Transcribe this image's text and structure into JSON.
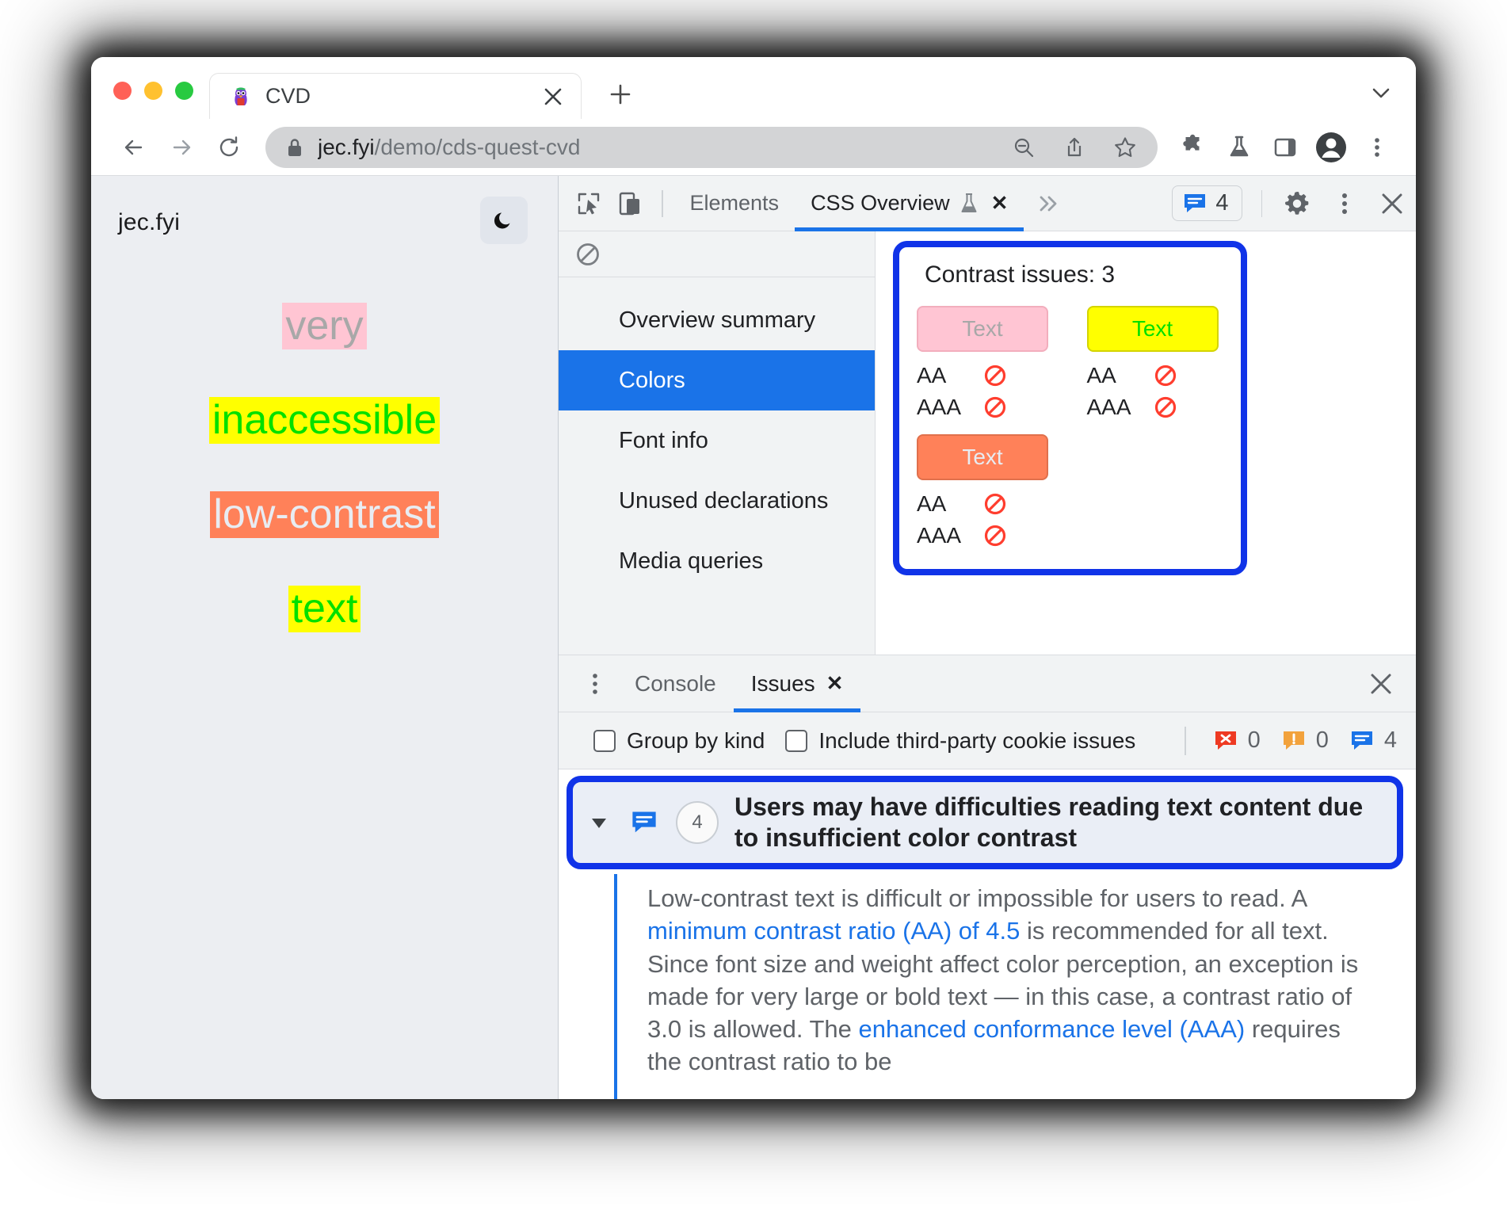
{
  "browser": {
    "tab": {
      "title": "CVD",
      "favicon_icon": "puffin-avatar-icon",
      "close_icon": "close-icon"
    },
    "new_tab_icon": "plus-icon",
    "tablist_chevron_icon": "chevron-down-icon",
    "nav": {
      "back_icon": "arrow-left-icon",
      "forward_icon": "arrow-right-icon",
      "reload_icon": "reload-icon"
    },
    "omnibox": {
      "lock_icon": "lock-icon",
      "url_host": "jec.fyi",
      "url_path": "/demo/cds-quest-cvd",
      "zoom_out_icon": "zoom-out-icon",
      "share_icon": "share-icon",
      "bookmark_icon": "star-icon"
    },
    "toolbar_icons": [
      "extensions-puzzle-icon",
      "experiments-flask-icon",
      "side-panel-icon",
      "profile-avatar-icon",
      "chrome-menu-icon"
    ]
  },
  "page": {
    "brand": "jec.fyi",
    "theme_toggle_icon": "moon-icon",
    "samples": [
      {
        "text": "very",
        "color": "#a8a8a8",
        "background": "#ffc5d3"
      },
      {
        "text": "inaccessible",
        "color": "#00e000",
        "background": "#ffff00"
      },
      {
        "text": "low-contrast",
        "color": "#e8ecf2",
        "background": "#ff8159"
      },
      {
        "text": "text",
        "color": "#00e000",
        "background": "#ffff00"
      }
    ]
  },
  "devtools": {
    "header": {
      "inspect_icon": "inspect-cursor-icon",
      "device_toggle_icon": "device-toolbar-icon",
      "tabs": [
        {
          "label": "Elements",
          "active": false
        },
        {
          "label": "CSS Overview",
          "active": true,
          "flask_icon": "experiment-flask-icon",
          "close_icon": "close-icon"
        }
      ],
      "more_tabs_icon": "chevron-double-right-icon",
      "issues_badge": {
        "icon": "issue-info-icon",
        "count": "4"
      },
      "settings_icon": "gear-icon",
      "kebab_icon": "kebab-menu-icon",
      "close_icon": "close-icon"
    },
    "css_overview": {
      "clear_icon": "clear-overview-icon",
      "menu": [
        {
          "label": "Overview summary",
          "selected": false
        },
        {
          "label": "Colors",
          "selected": true
        },
        {
          "label": "Font info",
          "selected": false
        },
        {
          "label": "Unused declarations",
          "selected": false
        },
        {
          "label": "Media queries",
          "selected": false
        }
      ],
      "contrast": {
        "title": "Contrast issues: 3",
        "highlight_color": "#1033e8",
        "swatches": [
          {
            "sample_label": "Text",
            "background": "#ffc5d3",
            "color": "#a8a8a8",
            "border": "#f2aebd",
            "levels": [
              {
                "label": "AA",
                "status_icon": "no-entry-icon",
                "pass": false
              },
              {
                "label": "AAA",
                "status_icon": "no-entry-icon",
                "pass": false
              }
            ]
          },
          {
            "sample_label": "Text",
            "background": "#ffff00",
            "color": "#00e000",
            "border": "#d4d400",
            "levels": [
              {
                "label": "AA",
                "status_icon": "no-entry-icon",
                "pass": false
              },
              {
                "label": "AAA",
                "status_icon": "no-entry-icon",
                "pass": false
              }
            ]
          },
          {
            "sample_label": "Text",
            "background": "#ff8159",
            "color": "#e8ecf2",
            "border": "#e0704c",
            "levels": [
              {
                "label": "AA",
                "status_icon": "no-entry-icon",
                "pass": false
              },
              {
                "label": "AAA",
                "status_icon": "no-entry-icon",
                "pass": false
              }
            ]
          }
        ]
      }
    },
    "drawer": {
      "kebab_icon": "kebab-menu-icon",
      "tabs": [
        {
          "label": "Console",
          "active": false
        },
        {
          "label": "Issues",
          "active": true,
          "close_icon": "close-icon"
        }
      ],
      "close_icon": "close-icon",
      "filters": {
        "group_by_kind": {
          "label": "Group by kind",
          "checked": false
        },
        "third_party": {
          "label": "Include third-party cookie issues",
          "checked": false
        },
        "counters": [
          {
            "icon": "issue-error-icon",
            "count": "0",
            "color": "#ee3a22"
          },
          {
            "icon": "issue-warning-icon",
            "count": "0",
            "color": "#f2a23c"
          },
          {
            "icon": "issue-info-icon",
            "count": "4",
            "color": "#1a73e8"
          }
        ]
      },
      "issue": {
        "caret_icon": "triangle-down-icon",
        "kind_icon": "issue-info-icon",
        "count": "4",
        "title": "Users may have difficulties reading text content due to insufficient color contrast",
        "description_parts": [
          {
            "text": "Low-contrast text is difficult or impossible for users to read. A ",
            "link": false
          },
          {
            "text": "minimum contrast ratio (AA) of 4.5",
            "link": true
          },
          {
            "text": " is recommended for all text. Since font size and weight affect color perception, an exception is made for very large or bold text — in this case, a contrast ratio of 3.0 is allowed. The ",
            "link": false
          },
          {
            "text": "enhanced conformance level (AAA)",
            "link": true
          },
          {
            "text": " requires the contrast ratio to be",
            "link": false
          }
        ]
      }
    }
  }
}
